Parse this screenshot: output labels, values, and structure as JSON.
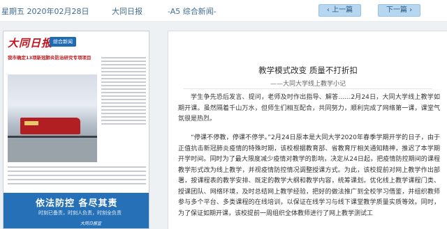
{
  "header": {
    "date": "星期五 2020年02月28日",
    "paper_name": "大同日报",
    "section": "-A5 综合新闻-",
    "prev_label": "上一篇",
    "next_label": "下一篇"
  },
  "thumbnail": {
    "logo": "大同日报",
    "badge": "综合新闻",
    "headline": "我市确定13项新冠肺炎防治研究专项项目",
    "banner_title": "依法防控 各尽其责",
    "banner_sub": "时刻已备责，时刻人负责，时刻全负责",
    "banner_sign": "大同日报宣"
  },
  "article": {
    "title": "教学模式改变 质量不打折扣",
    "subtitle": "——大同大学线上教学小记",
    "paragraphs": [
      "学生争先恐后发言、提问，老师及时作出指导、解答……2月24日，大同大学线上教学如期开课。虽然隔着千山万水，但师生们相互配合，共同努力，顺利完成了网络第一课，课堂气氛很是热烈。",
      "“停课不停教，停课不停学。”2月24日原本是大同大学2020年春季学期开学的日子，由于正值抗击新冠肺炎疫情的特殊时期，该校根据教育部、省教育厅相关通知精神，推迟了本学期开学时间。同时为了最大限度减少疫情对教学的影响，决定从24日起，把疫情防控期间的课程教学形式改为线上教学，并视疫情防控情况调整授课方式。为此，该校提前对网上教学作出部署，按课程表的教学安排、既定的教学大纲和教学内容，统筹课划。优化线上教学课程门类、授课团队、网络环境，及时总结网上教学经验，把好的做法推广到全校学习借鉴，并组织教师参与多个平台、多类课程的在线培训，以保证在线学习与线下课堂教学质量实质等效。同时，为了保证如期开课，该校提前一周组织全体教师进行了网上教学测试工"
    ]
  }
}
